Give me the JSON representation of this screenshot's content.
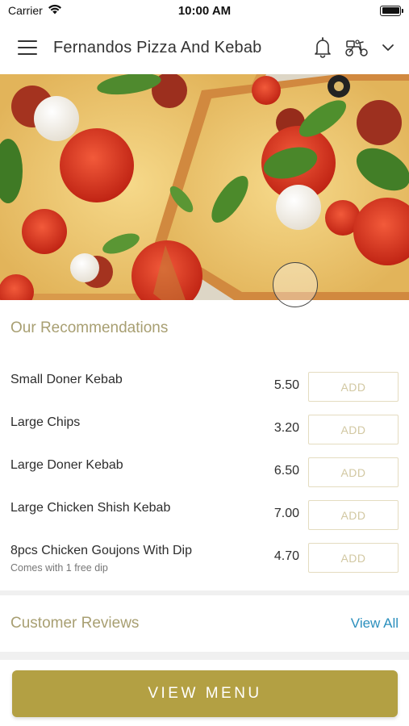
{
  "status_bar": {
    "carrier": "Carrier",
    "time": "10:00 AM",
    "icons": [
      "wifi-icon",
      "battery-icon"
    ]
  },
  "header": {
    "title": "Fernandos Pizza And Kebab",
    "icons": [
      "menu-icon",
      "bell-icon",
      "scooter-icon",
      "chevron-down-icon"
    ]
  },
  "hero": {
    "image": "pizza-photo"
  },
  "recommendations": {
    "title": "Our Recommendations",
    "add_label": "ADD",
    "items": [
      {
        "name": "Small Doner Kebab",
        "price": "5.50",
        "description": ""
      },
      {
        "name": "Large Chips",
        "price": "3.20",
        "description": ""
      },
      {
        "name": "Large Doner Kebab",
        "price": "6.50",
        "description": ""
      },
      {
        "name": "Large Chicken Shish Kebab",
        "price": "7.00",
        "description": ""
      },
      {
        "name": "8pcs Chicken Goujons With Dip",
        "price": "4.70",
        "description": "Comes with 1 free dip"
      }
    ]
  },
  "reviews": {
    "title": "Customer Reviews",
    "view_all_label": "View All"
  },
  "footer": {
    "view_menu_label": "VIEW MENU"
  },
  "colors": {
    "accent": "#b3a043",
    "section_title": "#a89f72",
    "link": "#2a8fbd",
    "add_border": "#e4dcc0"
  }
}
